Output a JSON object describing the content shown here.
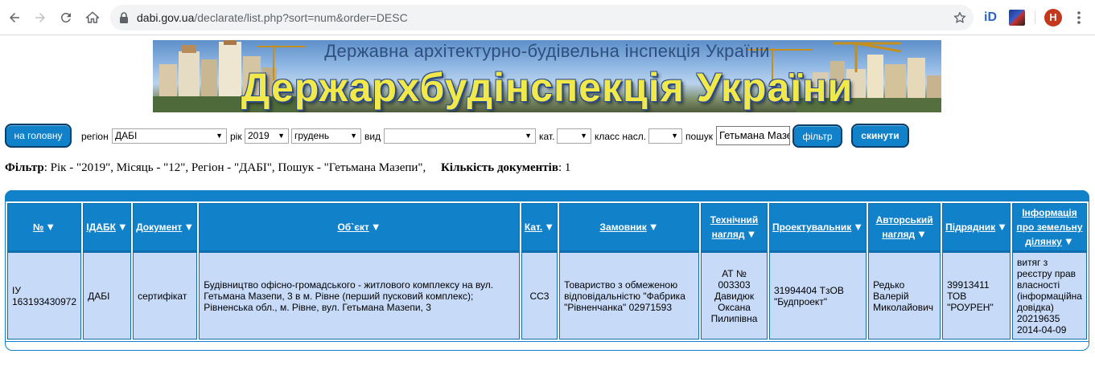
{
  "browser": {
    "url_host": "dabi.gov.ua",
    "url_path": "/declarate/list.php?sort=num&order=DESC",
    "ext_label": "iD",
    "avatar_letter": "H"
  },
  "banner": {
    "subtitle": "Державна архітектурно-будівельна інспекція України",
    "title": "Держархбудінспекція України"
  },
  "controls": {
    "home_button": "на головну",
    "region_label": "регіон",
    "region_value": "ДАБІ",
    "year_label": "рік",
    "year_value": "2019",
    "month_value": "грудень",
    "type_label": "вид",
    "type_value": "",
    "cat_label": "кат.",
    "cat_value": "",
    "class_label": "класс насл.",
    "class_value": "",
    "search_label": "пошук",
    "search_value": "Гетьмана Мазепи",
    "filter_button": "фільтр",
    "reset_button": "скинути"
  },
  "summary": {
    "filter_label": "Фільтр",
    "filter_text": ": Рік - \"2019\", Місяць - \"12\", Регіон - \"ДАБІ\", Пошук - \"Гетьмана Мазепи\",     ",
    "count_label": "Кількість документів",
    "count_value": ": 1"
  },
  "table": {
    "columns": [
      {
        "label": "№"
      },
      {
        "label": "ІДАБК"
      },
      {
        "label": "Документ"
      },
      {
        "label": "Об`єкт"
      },
      {
        "label": "Кат."
      },
      {
        "label": "Замовник"
      },
      {
        "label": "Технічний нагляд"
      },
      {
        "label": "Проектувальник"
      },
      {
        "label": "Авторський нагляд"
      },
      {
        "label": "Підрядник"
      },
      {
        "label": "Інформація про земельну ділянку"
      }
    ],
    "sort_glyph": "▼",
    "rows": [
      {
        "num": "ІУ 163193430972",
        "idabk": "ДАБІ",
        "document": "сертифікат",
        "object": "Будівництво офісно-громадського - житлового комплексу на вул. Гетьмана Мазепи, 3 в м. Рівне (перший пусковий комплекс); Рівненська обл., м. Рівне, вул. Гетьмана Мазепи, 3",
        "cat": "СС3",
        "customer": "Товариство з обмеженою відповідальністю \"Фабрика \"Рівненчанка\" 02971593",
        "tech": "АТ № 003303 Давидюк Оксана Пилипівна",
        "designer": "31994404 ТзОВ \"Будпроект\"",
        "author": "Редько Валерій Миколайович",
        "contractor": "39913411 ТОВ \"РОУРЕН\"",
        "land": "витяг з реєстру прав власності (інформаційна довідка) 20219635 2014-04-09"
      }
    ]
  }
}
